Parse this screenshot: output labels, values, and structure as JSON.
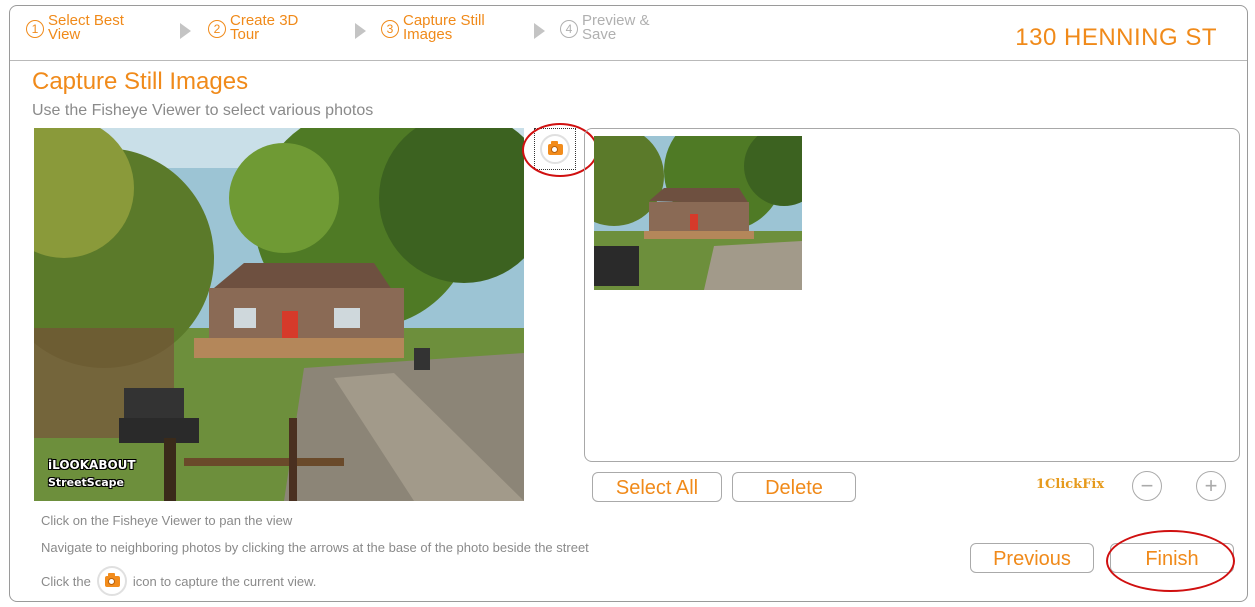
{
  "steps": [
    {
      "num": "1",
      "label": "Select Best\nView"
    },
    {
      "num": "2",
      "label": "Create 3D\nTour"
    },
    {
      "num": "3",
      "label": "Capture Still\nImages"
    },
    {
      "num": "4",
      "label": "Preview &\nSave"
    }
  ],
  "address": "130 HENNING ST",
  "title": "Capture Still Images",
  "subtitle": "Use the Fisheye Viewer to select various photos",
  "watermark": {
    "line1": "iLOOKABOUT",
    "line2": "StreetScape"
  },
  "buttons": {
    "select_all": "Select All",
    "delete": "Delete",
    "previous": "Previous",
    "finish": "Finish"
  },
  "one_click_fix": "1ClickFix",
  "zoom_minus": "−",
  "zoom_plus": "+",
  "help": {
    "line1": "Click on the Fisheye Viewer to pan the view",
    "line2": "Navigate to neighboring photos by clicking the arrows at the base of the photo beside the street",
    "line3_before": "Click the",
    "line3_after": "icon to capture the current view."
  },
  "icons": [
    "camera-icon"
  ],
  "colors": {
    "accent": "#f08a1a",
    "highlight_ring": "#d01010"
  }
}
